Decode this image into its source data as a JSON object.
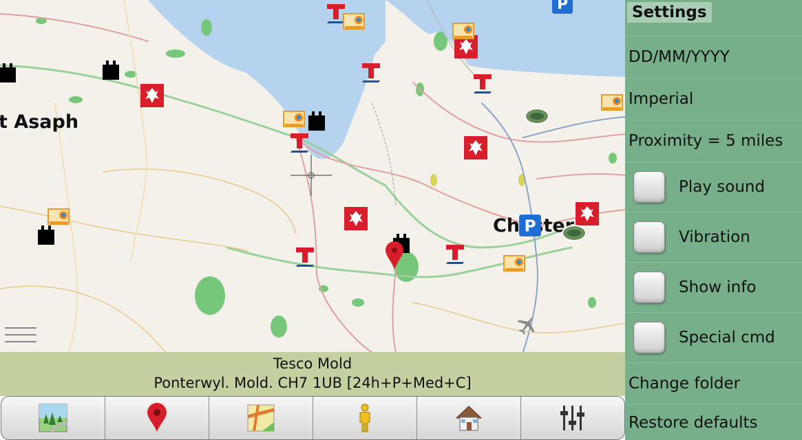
{
  "map": {
    "place_labels": [
      "t Asaph",
      "Chester"
    ]
  },
  "info_bar": {
    "title": "Tesco Mold",
    "address": "Ponterwyl. Mold. CH7 1UB [24h+P+Med+C]"
  },
  "toolbar": {
    "buttons": [
      {
        "name": "map-view-button",
        "icon": "landscape-icon"
      },
      {
        "name": "add-poi-button",
        "icon": "map-pin-icon"
      },
      {
        "name": "route-button",
        "icon": "road-map-icon"
      },
      {
        "name": "walk-mode-button",
        "icon": "person-icon"
      },
      {
        "name": "home-button",
        "icon": "house-icon"
      },
      {
        "name": "settings-button",
        "icon": "sliders-icon"
      }
    ]
  },
  "settings": {
    "title": "Settings",
    "date_format": "DD/MM/YYYY",
    "units": "Imperial",
    "proximity": "Proximity = 5 miles",
    "play_sound": "Play sound",
    "vibration": "Vibration",
    "show_info": "Show info",
    "special_cmd": "Special cmd",
    "change_folder": "Change folder",
    "restore_defaults": "Restore defaults"
  },
  "colors": {
    "water": "#b5d3ef",
    "woodland": "#77c77a",
    "settings_bg": "#77af8b",
    "info_bg": "#c5d0a0",
    "poi_red": "#d71e2a",
    "poi_blue": "#1f6ed6"
  }
}
